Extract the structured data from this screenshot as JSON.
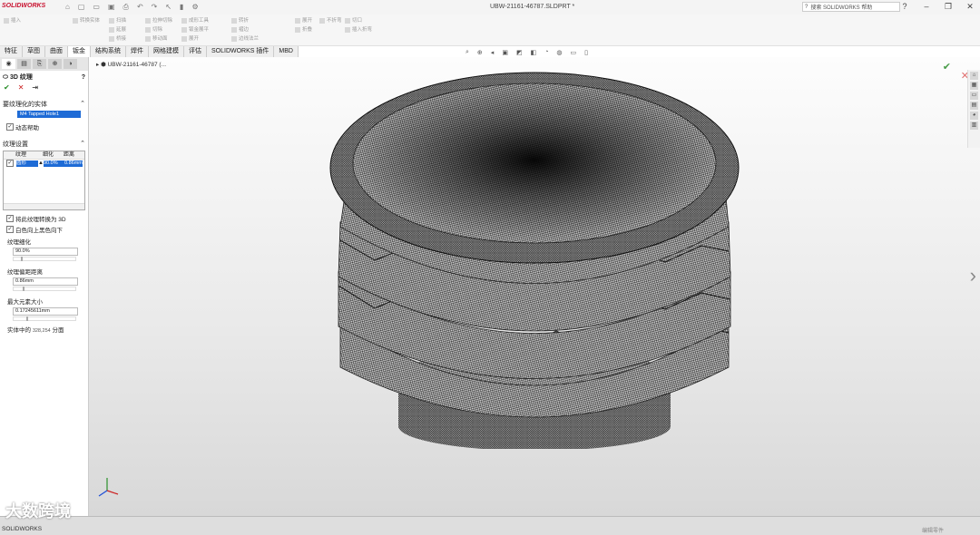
{
  "app": {
    "logo": "SOLIDWORKS",
    "document_title": "UBW-21161-46787.SLDPRT *",
    "search_placeholder": "搜索 SOLIDWORKS 帮助"
  },
  "ribbon_groups": [
    [
      "插入",
      ""
    ],
    [
      "转换实体",
      "",
      ""
    ],
    [
      "扫描",
      "延展",
      "桥接"
    ],
    [
      "拉伸切除",
      "切除",
      "移动面"
    ],
    [
      "成形工具",
      "钣金展平",
      "展开"
    ],
    [
      "转折",
      "褶边",
      "边线法兰"
    ],
    [
      "拉伸切除",
      "正交切除",
      "转换到钣金"
    ],
    [
      "展开",
      "折叠"
    ],
    [
      "不折弯"
    ],
    [
      "切口",
      "插入折弯"
    ]
  ],
  "command_tabs": [
    "特征",
    "草图",
    "曲面",
    "钣金",
    "结构系统",
    "焊件",
    "网格建模",
    "评估",
    "SOLIDWORKS 插件",
    "MBD"
  ],
  "active_tab": "钣金",
  "panel": {
    "title": "3D 纹理",
    "section_bodies": "要纹理化的实体",
    "selected_body": "M4 Tapped Hole1",
    "dynamic_help": "动态帮助",
    "section_texture": "纹理设置",
    "table_headers": [
      "纹理",
      "细化",
      "距离"
    ],
    "table_row": [
      "圆形",
      "90.0%",
      "0.86mm"
    ],
    "chk_convert": "将此纹理转换为 3D",
    "chk_white": "白色向上黑色向下",
    "refine_label": "纹理细化",
    "refine_value": "90.0%",
    "offset_label": "纹理偏距距离",
    "offset_value": "0.86mm",
    "max_label": "最大元素大小",
    "max_value": "0.17245611mm",
    "facets_label": "实体中的",
    "facets_count": "328,254",
    "facets_unit": "分面"
  },
  "viewport": {
    "breadcrumb": "UBW-21161-46787 (..."
  },
  "status": {
    "text": "SOLIDWORKS",
    "right": "编辑零件"
  },
  "watermark": "大数跨境"
}
